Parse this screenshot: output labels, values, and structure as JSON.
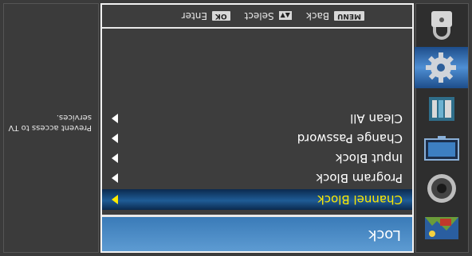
{
  "sidebar": {
    "icons": [
      {
        "name": "picture-icon",
        "active": false
      },
      {
        "name": "speaker-icon",
        "active": false
      },
      {
        "name": "tv-screen-icon",
        "active": false
      },
      {
        "name": "channel-icon",
        "active": false
      },
      {
        "name": "settings-gear-icon",
        "active": true
      },
      {
        "name": "lock-icon",
        "active": false
      }
    ]
  },
  "menu": {
    "title": "Lock",
    "items": [
      {
        "label": "Channel Block",
        "selected": true
      },
      {
        "label": "Program Block",
        "selected": false
      },
      {
        "label": "Input Block",
        "selected": false
      },
      {
        "label": "Change Password",
        "selected": false
      },
      {
        "label": "Clean All",
        "selected": false
      }
    ]
  },
  "hints": {
    "ok_key": "OK",
    "ok_label": "Enter",
    "select_label": "Select",
    "menu_key": "MENU",
    "menu_label": "Back"
  },
  "description": {
    "text": "Prevent access to TV services."
  },
  "colors": {
    "highlight_text": "#ffea00",
    "title_bar": "#4a8ac6",
    "selected_bar": "#1f5c96",
    "active_icon_bg": "#4f8fd4"
  }
}
